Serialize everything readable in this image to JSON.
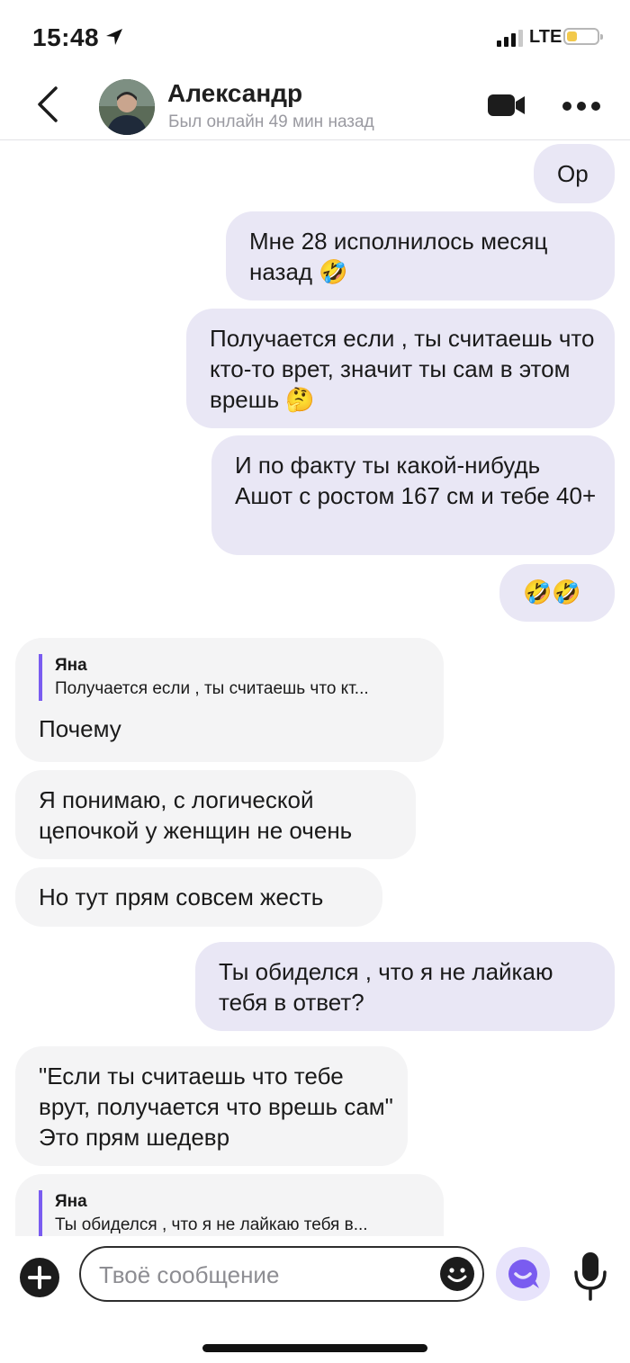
{
  "status_bar": {
    "time": "15:48",
    "network": "LTE",
    "battery_level": 0.33
  },
  "header": {
    "name": "Александр",
    "status": "Был онлайн 49 мин назад"
  },
  "messages": [
    {
      "dir": "out",
      "text": "Ор"
    },
    {
      "dir": "out",
      "text": "Мне 28 исполнилось месяц назад",
      "emoji": "🤣"
    },
    {
      "dir": "out",
      "text": "Получается если , ты считаешь что кто-то врет, значит ты сам в этом врешь",
      "emoji": "🤔"
    },
    {
      "dir": "out",
      "text": "И по факту ты какой-нибудь Ашот с ростом 167 см и тебе 40+"
    },
    {
      "dir": "out",
      "emoji": "🤣🤣"
    },
    {
      "dir": "in",
      "reply_name": "Яна",
      "reply_text": "Получается если , ты считаешь что кт...",
      "text": "Почему"
    },
    {
      "dir": "in",
      "text": "Я понимаю, с логической цепочкой у женщин не очень"
    },
    {
      "dir": "in",
      "text": "Но тут прям совсем жесть"
    },
    {
      "dir": "out",
      "text": "Ты обиделся , что я не лайкаю тебя в ответ?"
    },
    {
      "dir": "in",
      "text": "\"Если ты считаешь что тебе врут, получается что врешь сам\" Это прям шедевр"
    },
    {
      "dir": "in",
      "reply_name": "Яна",
      "reply_text": "Ты обиделся , что я не лайкаю тебя в..."
    }
  ],
  "composer": {
    "placeholder": "Твоё сообщение"
  },
  "colors": {
    "outgoing_bubble": "#e9e7f5",
    "incoming_bubble": "#f4f4f5",
    "accent": "#7a5cf0",
    "battery": "#f2c94c"
  },
  "icons": [
    "back-chevron-icon",
    "video-camera-icon",
    "more-dots-icon",
    "plus-icon",
    "smile-icon",
    "assistant-icon",
    "microphone-icon",
    "location-arrow-icon"
  ]
}
